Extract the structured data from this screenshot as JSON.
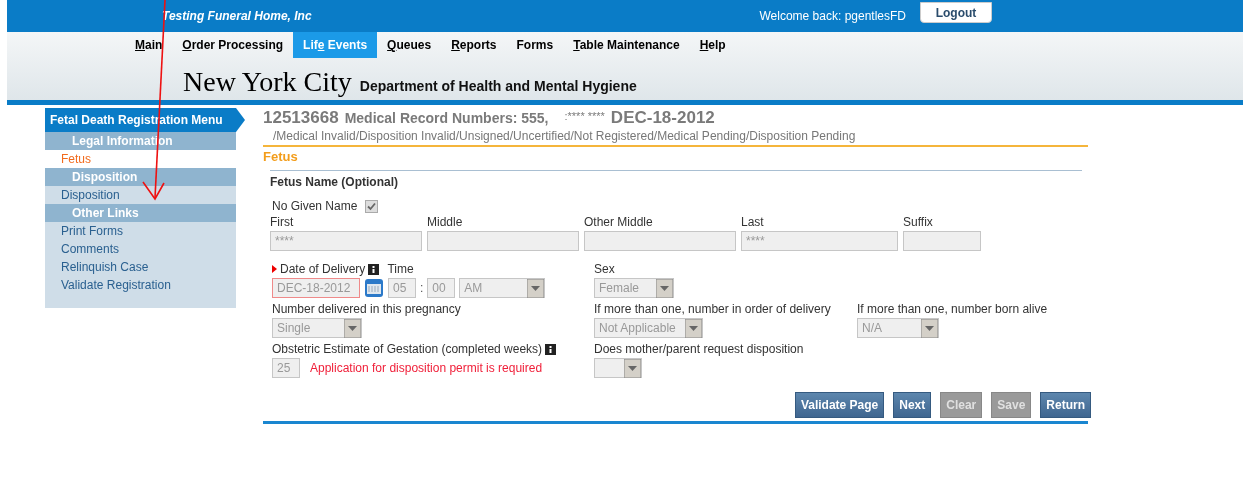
{
  "top_bar": {
    "organization": "Testing Funeral Home, Inc",
    "welcome": "Welcome back: pgentlesFD",
    "logout": "Logout"
  },
  "nav": [
    {
      "key": "M",
      "post": "ain",
      "selected": false
    },
    {
      "key": "O",
      "post": "rder Processing",
      "selected": false
    },
    {
      "pre": "Lif",
      "key": "e",
      "post": " Events",
      "selected": true
    },
    {
      "key": "Q",
      "post": "ueues",
      "selected": false
    },
    {
      "key": "R",
      "post": "eports",
      "selected": false
    },
    {
      "pre": "Forms",
      "selected": false
    },
    {
      "key": "T",
      "post": "able Maintenance",
      "selected": false
    },
    {
      "key": "H",
      "post": "elp",
      "selected": false
    }
  ],
  "banner": {
    "city": "New York City",
    "department": "Department of Health and Mental Hygiene"
  },
  "sidebar": {
    "title": "Fetal Death Registration Menu",
    "items": [
      {
        "kind": "section",
        "label": "Legal Information"
      },
      {
        "kind": "link",
        "label": "Fetus",
        "selected": true
      },
      {
        "kind": "section",
        "label": "Disposition"
      },
      {
        "kind": "link",
        "label": "Disposition",
        "selected": false
      },
      {
        "kind": "section",
        "label": "Other Links"
      },
      {
        "kind": "link",
        "label": "Print Forms",
        "selected": false
      },
      {
        "kind": "link",
        "label": "Comments",
        "selected": false
      },
      {
        "kind": "link",
        "label": "Relinquish Case",
        "selected": false
      },
      {
        "kind": "link",
        "label": "Validate Registration",
        "selected": false
      }
    ]
  },
  "record": {
    "number": "12513668",
    "medical_record": "Medical Record Numbers: 555,",
    "name": ":**** ****",
    "date": "DEC-18-2012",
    "status": "/Medical Invalid/Disposition Invalid/Unsigned/Uncertified/Not Registered/Medical Pending/Disposition Pending"
  },
  "section_title": "Fetus",
  "fetus_name": {
    "heading": "Fetus Name (Optional)",
    "no_given_name": {
      "label": "No Given Name",
      "checked": true
    },
    "fields": [
      {
        "label": "First",
        "value": "****"
      },
      {
        "label": "Middle"
      },
      {
        "label": "Other Middle"
      },
      {
        "label": "Last",
        "value": "****"
      },
      {
        "label": "Suffix"
      }
    ]
  },
  "delivery": {
    "date_label": "Date of Delivery",
    "required": true,
    "date": "DEC-18-2012",
    "time_label": "Time",
    "hour": "05",
    "separator": ":",
    "minute": "00",
    "ampm": "AM"
  },
  "sex": {
    "label": "Sex",
    "value": "Female"
  },
  "number_delivered": {
    "label": "Number delivered in this pregnancy",
    "value": "Single"
  },
  "order_of_delivery": {
    "label": "If more than one, number in order of delivery",
    "value": "Not Applicable"
  },
  "born_alive": {
    "label": "If more than one, number born alive",
    "value": "N/A"
  },
  "gestation": {
    "label": "Obstetric Estimate of Gestation (completed weeks)",
    "value": "25",
    "message": "Application for disposition permit is required"
  },
  "disposition_request": {
    "label": "Does mother/parent request disposition"
  },
  "buttons": [
    {
      "label": "Validate Page",
      "disabled": false
    },
    {
      "label": "Next",
      "disabled": false
    },
    {
      "label": "Clear",
      "disabled": true
    },
    {
      "label": "Save",
      "disabled": true
    },
    {
      "label": "Return",
      "disabled": false
    }
  ]
}
